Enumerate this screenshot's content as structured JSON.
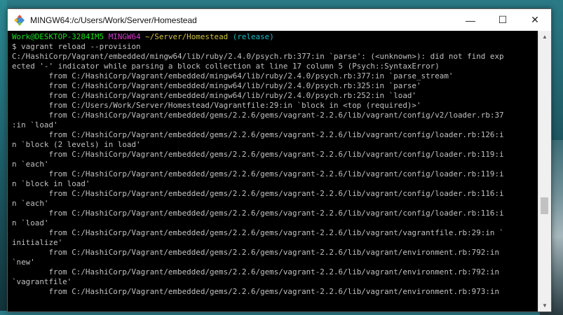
{
  "window": {
    "title": "MINGW64:/c/Users/Work/Server/Homestead",
    "controls": {
      "minimize": "—",
      "maximize": "☐",
      "close": "✕"
    }
  },
  "scrollbar": {
    "up": "▲",
    "down": "▼"
  },
  "terminal": {
    "prompt": {
      "user_host": "Work@DESKTOP-3284IM5",
      "shell": "MINGW64",
      "path": "~/Server/Homestead",
      "branch": "(release)"
    },
    "command": "$ vagrant reload --provision",
    "output": [
      "C:/HashiCorp/Vagrant/embedded/mingw64/lib/ruby/2.4.0/psych.rb:377:in `parse': (<unknown>): did not find exp",
      "ected '-' indicator while parsing a block collection at line 17 column 5 (Psych::SyntaxError)",
      "        from C:/HashiCorp/Vagrant/embedded/mingw64/lib/ruby/2.4.0/psych.rb:377:in `parse_stream'",
      "        from C:/HashiCorp/Vagrant/embedded/mingw64/lib/ruby/2.4.0/psych.rb:325:in `parse'",
      "        from C:/HashiCorp/Vagrant/embedded/mingw64/lib/ruby/2.4.0/psych.rb:252:in `load'",
      "        from C:/Users/Work/Server/Homestead/Vagrantfile:29:in `block in <top (required)>'",
      "        from C:/HashiCorp/Vagrant/embedded/gems/2.2.6/gems/vagrant-2.2.6/lib/vagrant/config/v2/loader.rb:37",
      ":in `load'",
      "        from C:/HashiCorp/Vagrant/embedded/gems/2.2.6/gems/vagrant-2.2.6/lib/vagrant/config/loader.rb:126:i",
      "n `block (2 levels) in load'",
      "        from C:/HashiCorp/Vagrant/embedded/gems/2.2.6/gems/vagrant-2.2.6/lib/vagrant/config/loader.rb:119:i",
      "n `each'",
      "        from C:/HashiCorp/Vagrant/embedded/gems/2.2.6/gems/vagrant-2.2.6/lib/vagrant/config/loader.rb:119:i",
      "n `block in load'",
      "        from C:/HashiCorp/Vagrant/embedded/gems/2.2.6/gems/vagrant-2.2.6/lib/vagrant/config/loader.rb:116:i",
      "n `each'",
      "        from C:/HashiCorp/Vagrant/embedded/gems/2.2.6/gems/vagrant-2.2.6/lib/vagrant/config/loader.rb:116:i",
      "n `load'",
      "        from C:/HashiCorp/Vagrant/embedded/gems/2.2.6/gems/vagrant-2.2.6/lib/vagrant/vagrantfile.rb:29:in `",
      "initialize'",
      "        from C:/HashiCorp/Vagrant/embedded/gems/2.2.6/gems/vagrant-2.2.6/lib/vagrant/environment.rb:792:in",
      "`new'",
      "        from C:/HashiCorp/Vagrant/embedded/gems/2.2.6/gems/vagrant-2.2.6/lib/vagrant/environment.rb:792:in",
      "`vagrantfile'",
      "        from C:/HashiCorp/Vagrant/embedded/gems/2.2.6/gems/vagrant-2.2.6/lib/vagrant/environment.rb:973:in"
    ]
  },
  "colors": {
    "prompt_user": "#14e31b",
    "prompt_shell": "#d23ac7",
    "prompt_path": "#cfc13e",
    "prompt_branch": "#1ab8c6",
    "output_text": "#c0c0c0",
    "background": "#000000"
  },
  "icons": {
    "app": "git-bash-icon"
  }
}
